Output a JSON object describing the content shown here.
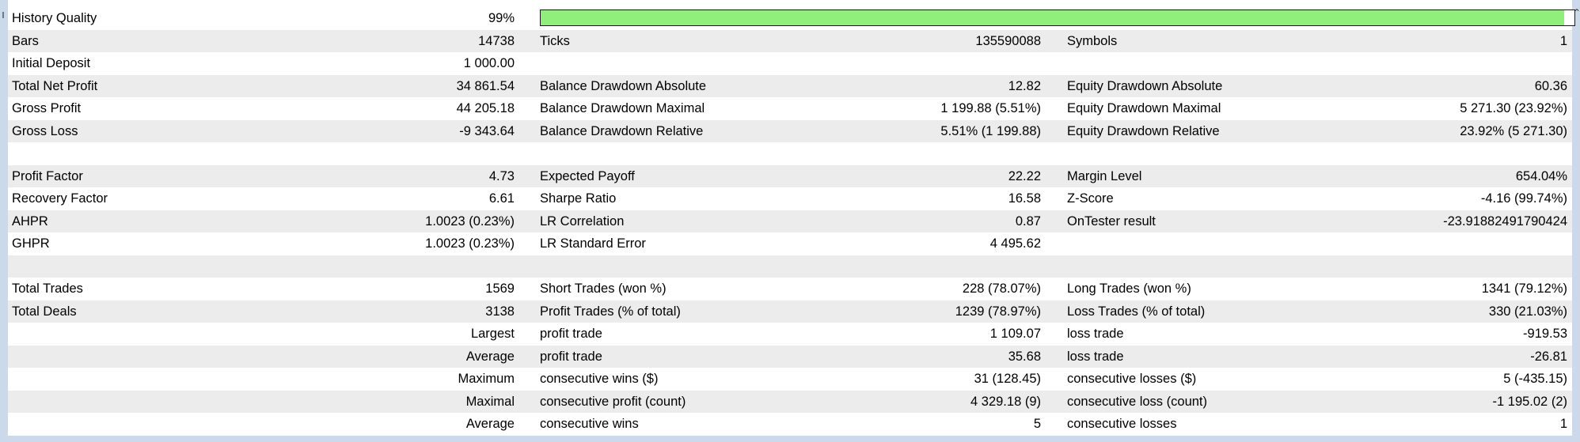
{
  "history_quality": {
    "label": "History Quality",
    "value": "99%",
    "progress_percent": 99,
    "bar_color": "#90ee7a"
  },
  "rows": [
    {
      "shade": true,
      "c1": "Bars",
      "c2": "14738",
      "c3": "Ticks",
      "c4": "135590088",
      "c5": "Symbols",
      "c6": "1"
    },
    {
      "shade": false,
      "c1": "Initial Deposit",
      "c2": "1 000.00",
      "c3": "",
      "c4": "",
      "c5": "",
      "c6": ""
    },
    {
      "shade": true,
      "c1": "Total Net Profit",
      "c2": "34 861.54",
      "c3": "Balance Drawdown Absolute",
      "c4": "12.82",
      "c5": "Equity Drawdown Absolute",
      "c6": "60.36"
    },
    {
      "shade": false,
      "c1": "Gross Profit",
      "c2": "44 205.18",
      "c3": "Balance Drawdown Maximal",
      "c4": "1 199.88 (5.51%)",
      "c5": "Equity Drawdown Maximal",
      "c6": "5 271.30 (23.92%)"
    },
    {
      "shade": true,
      "c1": "Gross Loss",
      "c2": "-9 343.64",
      "c3": "Balance Drawdown Relative",
      "c4": "5.51% (1 199.88)",
      "c5": "Equity Drawdown Relative",
      "c6": "23.92% (5 271.30)"
    },
    {
      "shade": false,
      "c1": "",
      "c2": "",
      "c3": "",
      "c4": "",
      "c5": "",
      "c6": ""
    },
    {
      "shade": true,
      "c1": "Profit Factor",
      "c2": "4.73",
      "c3": "Expected Payoff",
      "c4": "22.22",
      "c5": "Margin Level",
      "c6": "654.04%"
    },
    {
      "shade": false,
      "c1": "Recovery Factor",
      "c2": "6.61",
      "c3": "Sharpe Ratio",
      "c4": "16.58",
      "c5": "Z-Score",
      "c6": "-4.16 (99.74%)"
    },
    {
      "shade": true,
      "c1": "AHPR",
      "c2": "1.0023 (0.23%)",
      "c3": "LR Correlation",
      "c4": "0.87",
      "c5": "OnTester result",
      "c6": "-23.91882491790424"
    },
    {
      "shade": false,
      "c1": "GHPR",
      "c2": "1.0023 (0.23%)",
      "c3": "LR Standard Error",
      "c4": "4 495.62",
      "c5": "",
      "c6": ""
    },
    {
      "shade": true,
      "c1": "",
      "c2": "",
      "c3": "",
      "c4": "",
      "c5": "",
      "c6": ""
    },
    {
      "shade": false,
      "c1": "Total Trades",
      "c2": "1569",
      "c3": "Short Trades (won %)",
      "c4": "228 (78.07%)",
      "c5": "Long Trades (won %)",
      "c6": "1341 (79.12%)"
    },
    {
      "shade": true,
      "c1": "Total Deals",
      "c2": "3138",
      "c3": "Profit Trades (% of total)",
      "c4": "1239 (78.97%)",
      "c5": "Loss Trades (% of total)",
      "c6": "330 (21.03%)"
    },
    {
      "shade": false,
      "c1": "",
      "c2": "Largest",
      "c3": "profit trade",
      "c4": "1 109.07",
      "c5": "loss trade",
      "c6": "-919.53"
    },
    {
      "shade": true,
      "c1": "",
      "c2": "Average",
      "c3": "profit trade",
      "c4": "35.68",
      "c5": "loss trade",
      "c6": "-26.81"
    },
    {
      "shade": false,
      "c1": "",
      "c2": "Maximum",
      "c3": "consecutive wins ($)",
      "c4": "31 (128.45)",
      "c5": "consecutive losses ($)",
      "c6": "5 (-435.15)"
    },
    {
      "shade": true,
      "c1": "",
      "c2": "Maximal",
      "c3": "consecutive profit (count)",
      "c4": "4 329.18 (9)",
      "c5": "consecutive loss (count)",
      "c6": "-1 195.02 (2)"
    },
    {
      "shade": false,
      "c1": "",
      "c2": "Average",
      "c3": "consecutive wins",
      "c4": "5",
      "c5": "consecutive losses",
      "c6": "1"
    }
  ],
  "colors": {
    "row_shade": "#ececec",
    "frame": "#ccd9ea"
  }
}
